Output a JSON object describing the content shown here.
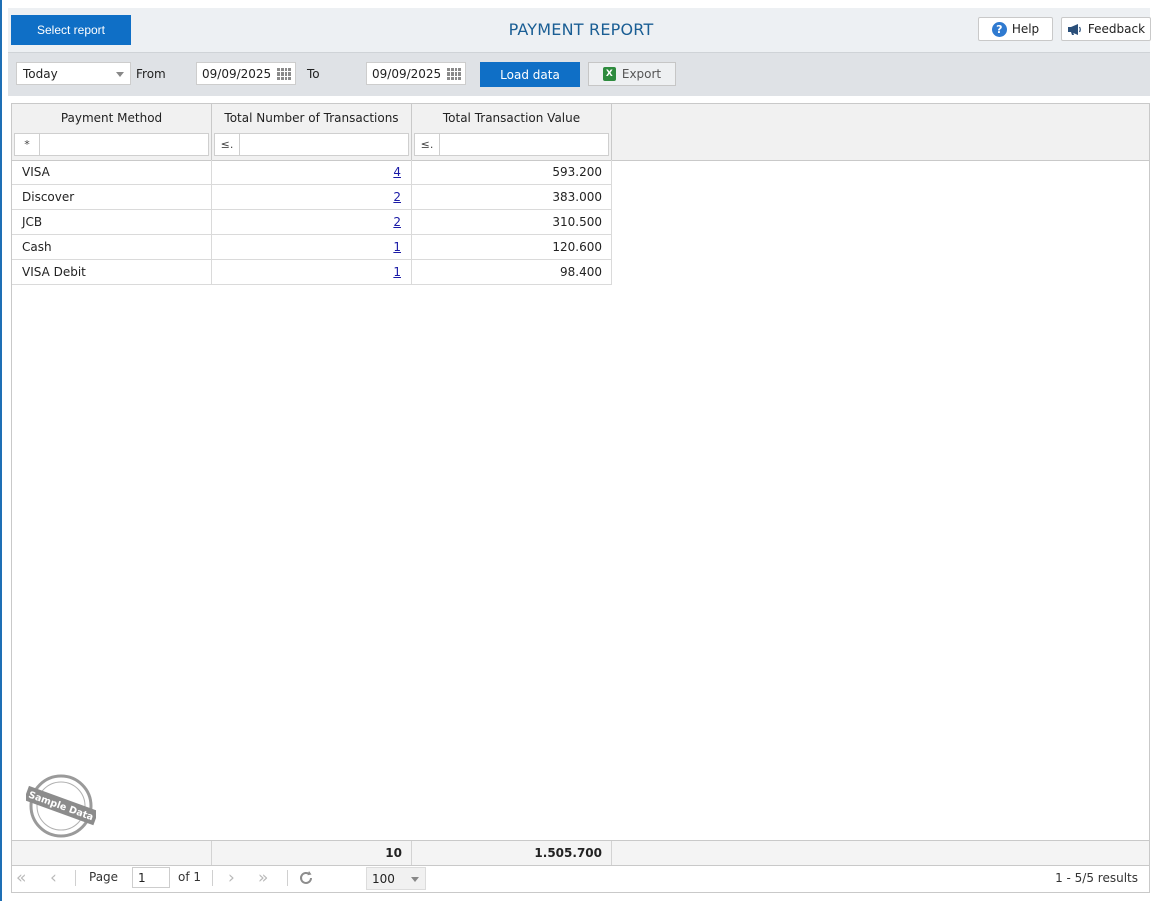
{
  "header": {
    "select_report_label": "Select report",
    "title": "PAYMENT REPORT",
    "help_label": "Help",
    "feedback_label": "Feedback"
  },
  "toolbar": {
    "period_value": "Today",
    "from_label": "From",
    "from_date": "09/09/2025",
    "to_label": "To",
    "to_date": "09/09/2025",
    "load_label": "Load data",
    "export_label": "Export"
  },
  "grid": {
    "columns": [
      "Payment Method",
      "Total Number of Transactions",
      "Total Transaction Value"
    ],
    "filter_ops": [
      "*",
      "≤.",
      "≤."
    ],
    "rows": [
      {
        "method": "VISA",
        "count": "4",
        "value": "593.200"
      },
      {
        "method": "Discover",
        "count": "2",
        "value": "383.000"
      },
      {
        "method": "JCB",
        "count": "2",
        "value": "310.500"
      },
      {
        "method": "Cash",
        "count": "1",
        "value": "120.600"
      },
      {
        "method": "VISA Debit",
        "count": "1",
        "value": "98.400"
      }
    ],
    "totals": {
      "count": "10",
      "value": "1.505.700"
    }
  },
  "pager": {
    "page_label": "Page",
    "page_value": "1",
    "of_label": "of 1",
    "page_size": "100",
    "results": "1 - 5/5 results"
  },
  "watermark": "Sample Data",
  "colors": {
    "accent": "#0f6fc6",
    "title": "#1a5e94",
    "link": "#1a1aa6"
  }
}
